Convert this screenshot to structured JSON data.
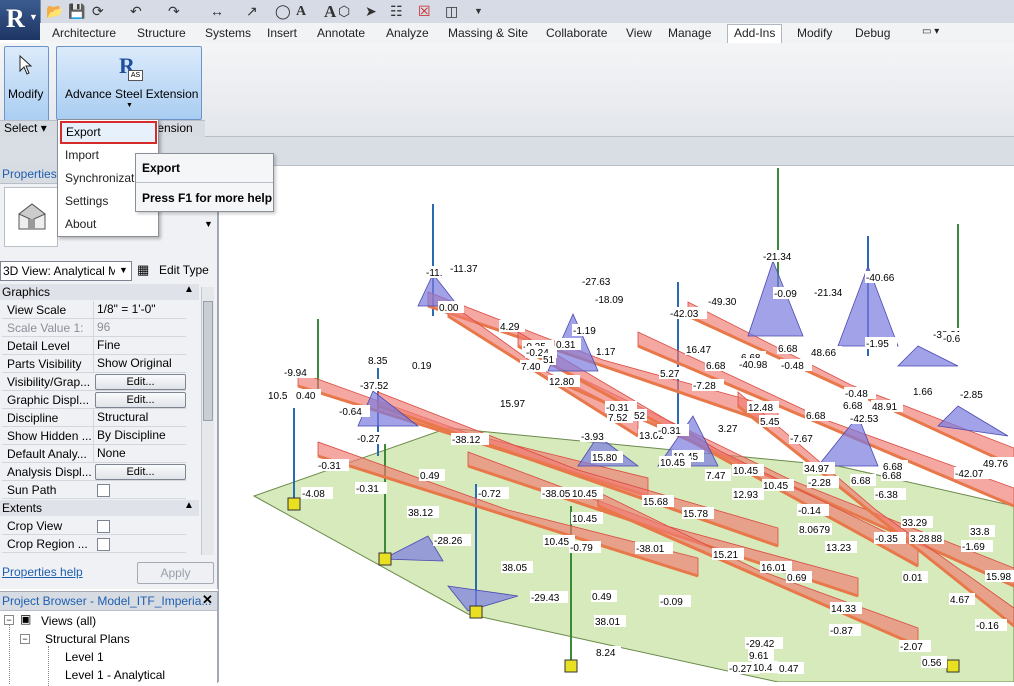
{
  "app": {
    "logo_letter": "R"
  },
  "tabs": [
    "Architecture",
    "Structure",
    "Systems",
    "Insert",
    "Annotate",
    "Analyze",
    "Massing & Site",
    "Collaborate",
    "View",
    "Manage",
    "Add-Ins",
    "Modify",
    "Debug"
  ],
  "active_tab": "Add-Ins",
  "ribbon": {
    "modify_label": "Modify",
    "select_label": "Select",
    "extension_button_label": "Advance Steel Extension",
    "extension_icon_text": "AS",
    "extension_panel_label": "tension"
  },
  "menu": {
    "items": [
      "Export",
      "Import",
      "Synchronizati",
      "Settings",
      "About"
    ],
    "highlighted": "Export"
  },
  "tooltip": {
    "title": "Export",
    "help": "Press F1 for more help"
  },
  "properties": {
    "title": "Properties",
    "type_selector": "3D View: Analytical M",
    "edit_type_label": "Edit Type",
    "groups": {
      "graphics": "Graphics",
      "extents": "Extents"
    },
    "rows": [
      {
        "k": "View Scale",
        "v": "1/8\" = 1'-0\""
      },
      {
        "k": "Scale Value    1:",
        "v": "96",
        "disabled": true
      },
      {
        "k": "Detail Level",
        "v": "Fine"
      },
      {
        "k": "Parts Visibility",
        "v": "Show Original"
      },
      {
        "k": "Visibility/Grap...",
        "v": "Edit...",
        "button": true
      },
      {
        "k": "Graphic Displ...",
        "v": "Edit...",
        "button": true
      },
      {
        "k": "Discipline",
        "v": "Structural"
      },
      {
        "k": "Show Hidden ...",
        "v": "By Discipline"
      },
      {
        "k": "Default Analy...",
        "v": "None"
      },
      {
        "k": "Analysis Displ...",
        "v": "Edit...",
        "button": true
      },
      {
        "k": "Sun Path",
        "v": "",
        "checkbox": true
      }
    ],
    "extent_rows": [
      {
        "k": "Crop View",
        "checkbox": true
      },
      {
        "k": "Crop Region ...",
        "checkbox": true
      }
    ],
    "help_link": "Properties help",
    "apply_label": "Apply"
  },
  "browser": {
    "title": "Project Browser - Model_ITF_Imperia...",
    "tree": [
      "Views (all)",
      "Structural Plans",
      "Level 1",
      "Level 1 - Analytical"
    ]
  },
  "viewport_labels": [
    "-21.34",
    "-11.",
    "-11.37",
    "-27.63",
    "-18.09",
    "-40.66",
    "-42.03",
    "-49.30",
    "-0.09",
    "-21.34",
    "-38.31",
    "0.00",
    "4.29",
    "-1.19",
    "-1.95",
    "-9.94",
    "8.35",
    "0.19",
    "-0.25",
    "-0.24",
    "0.31",
    "1.17",
    "16.47",
    "6.68",
    "6.68",
    "48.66",
    "-0.6",
    "10.5",
    "0.40",
    "-37.52",
    "7.40",
    "51",
    "5.27",
    "-7.28",
    "6.68",
    "-40.98",
    "-0.48",
    "1.66",
    "-2.85",
    "-0.64",
    "15.97",
    "12.80",
    "-0.31",
    "12.48",
    "-0.48",
    "6.68",
    "48.91",
    "-0.27",
    "-38.12",
    "7.52",
    "52",
    "-3.93",
    "13.02",
    "-0.31",
    "3.27",
    "5.45",
    "-7.67",
    "6.68",
    "-42.53",
    "-0.31",
    "15.80",
    "10.45",
    "10.45",
    "34.97",
    "-42.07",
    "0.49",
    "7.47",
    "10.45",
    "-2.28",
    "6.68",
    "6.68",
    "49.76",
    "-4.08",
    "-0.31",
    "-0.72",
    "-38.05",
    "10.45",
    "15.68",
    "12.93",
    "10.45",
    "6.68",
    "-6.38",
    "38.12",
    "10.45",
    "15.78",
    "-0.14",
    "33.29",
    "-28.26",
    "10.45",
    "-0.79",
    "-38.01",
    "8.06",
    "79",
    "-0.35",
    "3.28",
    "88",
    "-1.69",
    "38.05",
    "15.21",
    "13.23",
    "16.01",
    "0.69",
    "0.01",
    "-29.43",
    "0.49",
    "-0.09",
    "14.33",
    "4.67",
    "-0.16",
    "38.01",
    "-0.87",
    "8.24",
    "-29.42",
    "9.61",
    "-2.07",
    "-0.27",
    "10.4",
    "0.47",
    "0.56",
    "15.98",
    "33.8",
    "6.68"
  ],
  "colors": {
    "accent_red": "#d52b2b",
    "ribbon_blue": "#a9cdf1",
    "floor_green": "#c9e3a4"
  }
}
